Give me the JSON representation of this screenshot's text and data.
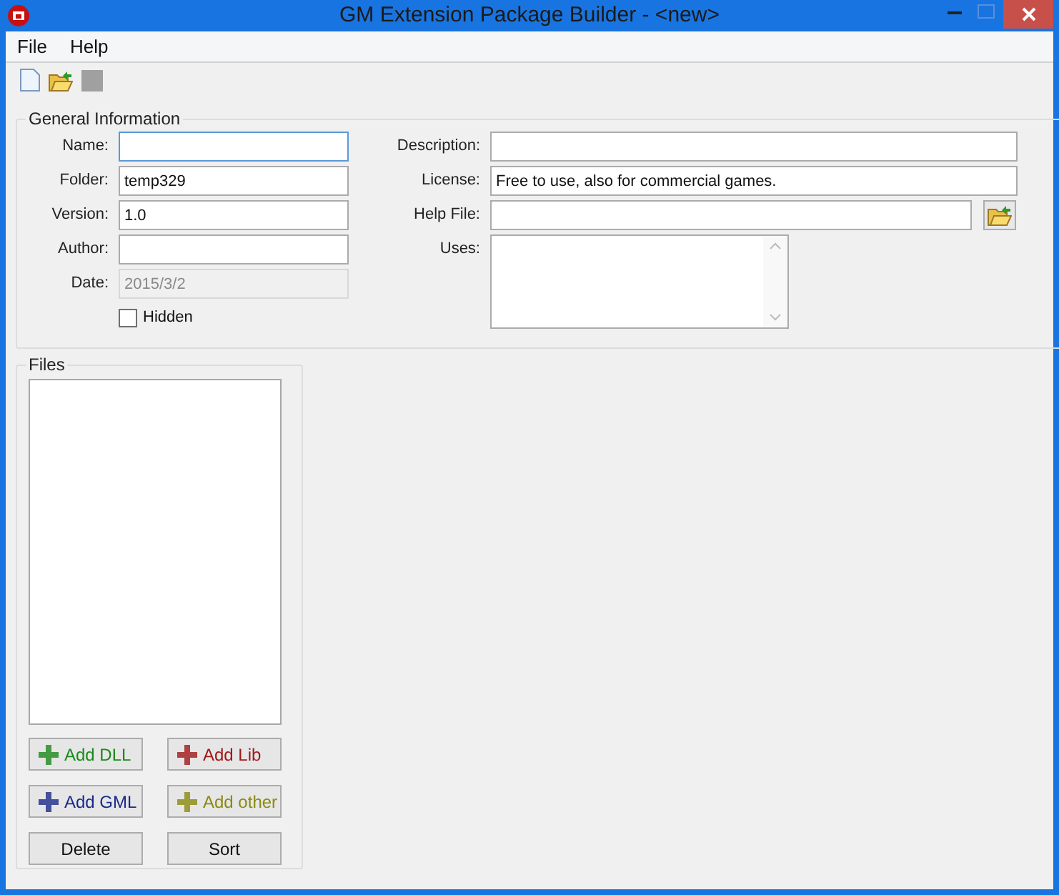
{
  "window": {
    "title": "GM Extension Package Builder - <new>"
  },
  "menu": [
    "File",
    "Help"
  ],
  "general": {
    "title": "General Information",
    "left_fields": [
      {
        "label": "Name:",
        "focused": true,
        "disabled": false
      },
      {
        "label": "Folder:",
        "value": "temp329",
        "focused": false,
        "disabled": false
      },
      {
        "label": "Version:",
        "value": "1.0",
        "focused": false,
        "disabled": false
      },
      {
        "label": "Author:",
        "focused": false,
        "disabled": false
      },
      {
        "label": "Date:",
        "value": "2015/3/2",
        "focused": false,
        "disabled": true
      }
    ],
    "hidden": {
      "label": "Hidden",
      "checked": false
    },
    "right_fields": [
      {
        "kind": "text",
        "label": "Description:"
      },
      {
        "kind": "text",
        "label": "License:",
        "value": "Free to use, also for commercial games."
      },
      {
        "kind": "browse",
        "label": "Help File:"
      },
      {
        "kind": "multiline",
        "label": "Uses:"
      }
    ]
  },
  "files": {
    "title": "Files",
    "buttons": [
      {
        "kind": "add",
        "label": "Add DLL",
        "color": "#1a8a1a"
      },
      {
        "kind": "add",
        "label": "Add Lib",
        "color": "#a01818"
      },
      {
        "kind": "add",
        "label": "Add GML",
        "color": "#1a2a8a"
      },
      {
        "kind": "add",
        "label": "Add other",
        "color": "#8a8a10"
      },
      {
        "kind": "plain",
        "label": "Delete"
      },
      {
        "kind": "plain",
        "label": "Sort"
      }
    ]
  }
}
